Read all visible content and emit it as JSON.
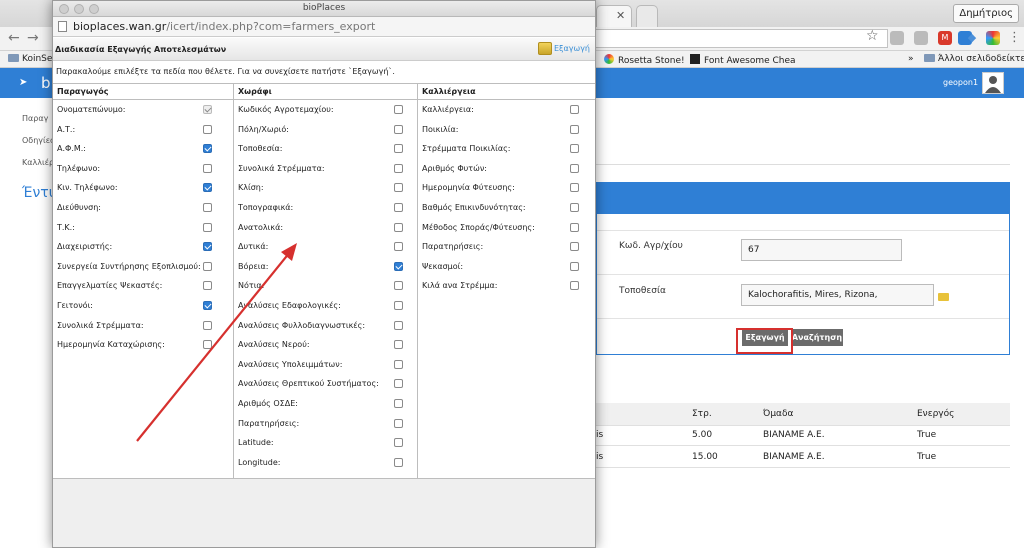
{
  "browser": {
    "user_button": "Δημήτριος",
    "bookmarks": {
      "left": "KoinSe",
      "rosetta": "Rosetta Stone!",
      "fontawesome": "Font Awesome Chea",
      "more": "»",
      "other": "Άλλοι σελιδοδείκτες"
    }
  },
  "app": {
    "brand_letter": "b",
    "username": "geopon1",
    "sidebar": [
      "Παραγ",
      "Οδηγίες",
      "Καλλιέρ"
    ],
    "page_heading": "Έντυ",
    "form": {
      "code_label": "Κωδ. Αγρ/χίου",
      "code_value": "67",
      "location_label": "Τοποθεσία",
      "location_value": "Kalochorafitis, Mires, Rizona,",
      "export_button": "Εξαγωγή",
      "search_button": "Αναζήτηση"
    },
    "table": {
      "headers": [
        "Στρ.",
        "Όμαδα",
        "Ενεργός"
      ],
      "rows": [
        {
          "name_tail": "is",
          "str": "5.00",
          "group": "BIANAME A.E.",
          "active": "True"
        },
        {
          "name_tail": "is",
          "str": "15.00",
          "group": "BIANAME A.E.",
          "active": "True"
        }
      ]
    }
  },
  "popup": {
    "window_title": "bioPlaces",
    "url_host": "bioplaces.wan.gr",
    "url_path": "/icert/index.php?com=farmers_export",
    "header_title": "Διαδικασία Εξαγωγής Αποτελεσμάτων",
    "export_label": "Εξαγωγή",
    "instructions": "Παρακαλούμε επιλέξτε τα πεδία που θέλετε. Για να συνεχίσετε πατήστε `Εξαγωγή`.",
    "columns": [
      {
        "title": "Παραγωγός",
        "fields": [
          {
            "label": "Ονοματεπώνυμο:",
            "state": "disabled"
          },
          {
            "label": "Α.Τ.:",
            "state": "off"
          },
          {
            "label": "Α.Φ.Μ.:",
            "state": "on"
          },
          {
            "label": "Τηλέφωνο:",
            "state": "off"
          },
          {
            "label": "Κιν. Τηλέφωνο:",
            "state": "on"
          },
          {
            "label": "Διεύθυνση:",
            "state": "off"
          },
          {
            "label": "Τ.Κ.:",
            "state": "off"
          },
          {
            "label": "Διαχειριστής:",
            "state": "on"
          },
          {
            "label": "Συνεργεία Συντήρησης Εξοπλισμού:",
            "state": "off"
          },
          {
            "label": "Επαγγελματίες Ψεκαστές:",
            "state": "off"
          },
          {
            "label": "Γειτονόι:",
            "state": "on"
          },
          {
            "label": "Συνολικά Στρέμματα:",
            "state": "off"
          },
          {
            "label": "Ημερομηνία Καταχώρισης:",
            "state": "off"
          }
        ]
      },
      {
        "title": "Χωράφι",
        "fields": [
          {
            "label": "Κωδικός Αγροτεμαχίου:",
            "state": "off"
          },
          {
            "label": "Πόλη/Χωριό:",
            "state": "off"
          },
          {
            "label": "Τοποθεσία:",
            "state": "off"
          },
          {
            "label": "Συνολικά Στρέμματα:",
            "state": "off"
          },
          {
            "label": "Κλίση:",
            "state": "off"
          },
          {
            "label": "Τοπογραφικά:",
            "state": "off"
          },
          {
            "label": "Ανατολικά:",
            "state": "off"
          },
          {
            "label": "Δυτικά:",
            "state": "off"
          },
          {
            "label": "Βόρεια:",
            "state": "on"
          },
          {
            "label": "Νότια:",
            "state": "off"
          },
          {
            "label": "Αναλύσεις Εδαφολογικές:",
            "state": "off"
          },
          {
            "label": "Αναλύσεις Φυλλοδιαγνωστικές:",
            "state": "off"
          },
          {
            "label": "Αναλύσεις Νερού:",
            "state": "off"
          },
          {
            "label": "Αναλύσεις Υπολειμμάτων:",
            "state": "off"
          },
          {
            "label": "Αναλύσεις Θρεπτικού Συστήματος:",
            "state": "off"
          },
          {
            "label": "Αριθμός ΟΣΔΕ:",
            "state": "off"
          },
          {
            "label": "Παρατηρήσεις:",
            "state": "off"
          },
          {
            "label": "Latitude:",
            "state": "off"
          },
          {
            "label": "Longitude:",
            "state": "off"
          }
        ]
      },
      {
        "title": "Καλλιέργεια",
        "fields": [
          {
            "label": "Καλλιέργεια:",
            "state": "off"
          },
          {
            "label": "Ποικιλία:",
            "state": "off"
          },
          {
            "label": "Στρέμματα Ποικιλίας:",
            "state": "off"
          },
          {
            "label": "Αριθμός Φυτών:",
            "state": "off"
          },
          {
            "label": "Ημερομηνία Φύτευσης:",
            "state": "off"
          },
          {
            "label": "Βαθμός Επικινδυνότητας:",
            "state": "off"
          },
          {
            "label": "Μέθοδος Σποράς/Φύτευσης:",
            "state": "off"
          },
          {
            "label": "Παρατηρήσεις:",
            "state": "off"
          },
          {
            "label": "Ψεκασμοί:",
            "state": "off"
          },
          {
            "label": "Κιλά ανα Στρέμμα:",
            "state": "off"
          }
        ]
      }
    ]
  },
  "colors": {
    "accent": "#2f7fd5",
    "annotation_red": "#d6302e"
  }
}
